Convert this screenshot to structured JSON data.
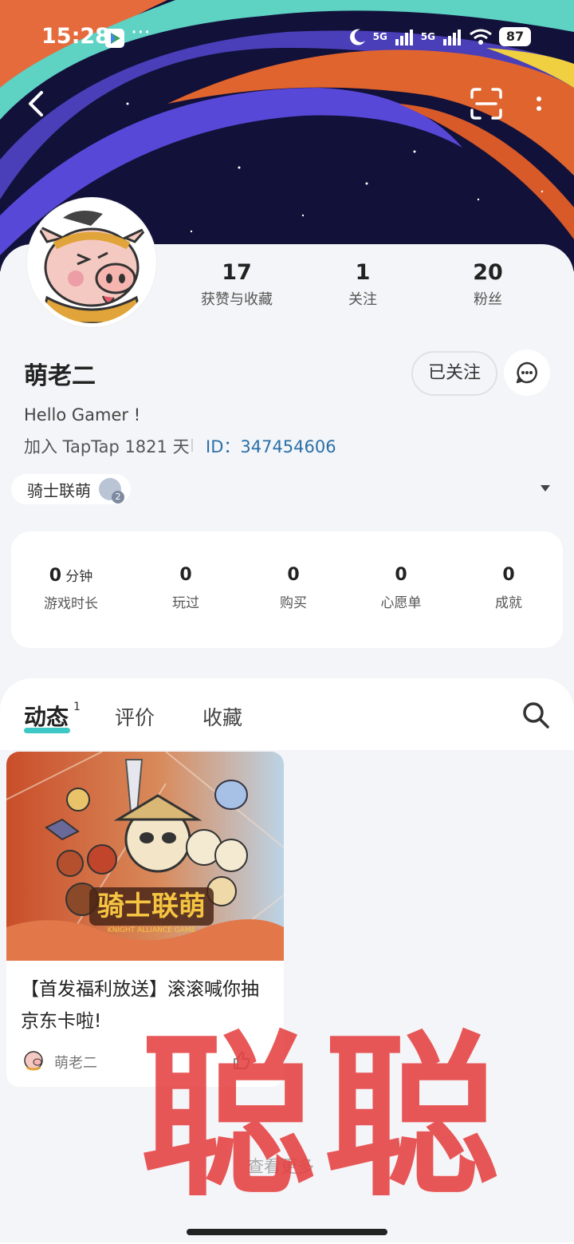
{
  "status_bar": {
    "time": "15:28",
    "more": "···",
    "signal_1": "5G",
    "signal_2": "5G",
    "battery": "87"
  },
  "profile": {
    "stats": [
      {
        "value": "17",
        "label": "获赞与收藏"
      },
      {
        "value": "1",
        "label": "关注"
      },
      {
        "value": "20",
        "label": "粉丝"
      }
    ],
    "name": "萌老二",
    "follow_label": "已关注",
    "bio": "Hello Gamer !",
    "joined": "加入 TapTap 1821 天",
    "id": "ID：347454606",
    "game_chip": "骑士联萌",
    "chip_badge": "2"
  },
  "game_stats": [
    {
      "value": "0",
      "unit": "分钟",
      "label": "游戏时长"
    },
    {
      "value": "0",
      "unit": "",
      "label": "玩过"
    },
    {
      "value": "0",
      "unit": "",
      "label": "购买"
    },
    {
      "value": "0",
      "unit": "",
      "label": "心愿单"
    },
    {
      "value": "0",
      "unit": "",
      "label": "成就"
    }
  ],
  "tabs": [
    {
      "label": "动态",
      "badge": "1"
    },
    {
      "label": "评价"
    },
    {
      "label": "收藏"
    }
  ],
  "post": {
    "image_text": "骑士联萌",
    "image_subtext": "KNIGHT ALLIANCE GAME",
    "title": "【首发福利放送】滚滚喊你抽京东卡啦!",
    "author": "萌老二",
    "likes": "0"
  },
  "view_more": "查看更多",
  "watermark": "聪聪",
  "colors": {
    "accent": "#3dc8c5",
    "id_link": "#2a6fa8",
    "watermark": "#e53d3d"
  }
}
